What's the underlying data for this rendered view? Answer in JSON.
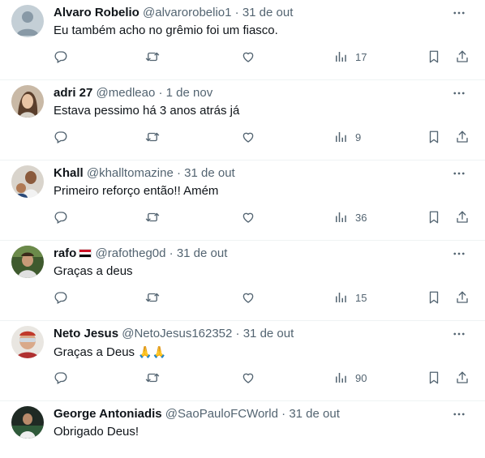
{
  "tweets": [
    {
      "name": "Alvaro Robelio",
      "handle": "@alvarorobelio1",
      "separator": "·",
      "time": "31 de out",
      "text": "Eu também acho no grêmio foi um fiasco.",
      "views": "17",
      "avatar": "default-avatar"
    },
    {
      "name": "adri 27",
      "handle": "@medleao",
      "separator": "·",
      "time": "1 de nov",
      "text": "Estava pessimo há 3 anos atrás já",
      "views": "9",
      "avatar": "photo-avatar"
    },
    {
      "name": "Khall",
      "handle": "@khalltomazine",
      "separator": "·",
      "time": "31 de out",
      "text": "Primeiro reforço então!! Amém",
      "views": "36",
      "avatar": "photo-avatar"
    },
    {
      "name": "rafo",
      "handle": "@rafotheg0d",
      "separator": "·",
      "time": "31 de out",
      "text": "Graças a deus",
      "views": "15",
      "avatar": "photo-avatar",
      "badge": "flag-icon"
    },
    {
      "name": "Neto Jesus",
      "handle": "@NetoJesus162352",
      "separator": "·",
      "time": "31 de out",
      "text": "Graças a Deus",
      "emoji": "🙏🙏",
      "views": "90",
      "avatar": "photo-avatar"
    },
    {
      "name": "George Antoniadis",
      "handle": "@SaoPauloFCWorld",
      "separator": "·",
      "time": "31 de out",
      "text": "Obrigado Deus!",
      "avatar": "photo-avatar"
    }
  ],
  "icons": {
    "more": "more-icon",
    "reply": "reply-icon",
    "retweet": "retweet-icon",
    "like": "like-icon",
    "views": "views-icon",
    "bookmark": "bookmark-icon",
    "share": "share-icon"
  },
  "colors": {
    "text": "#0f1419",
    "secondary": "#536471",
    "divider": "#eff3f4"
  }
}
